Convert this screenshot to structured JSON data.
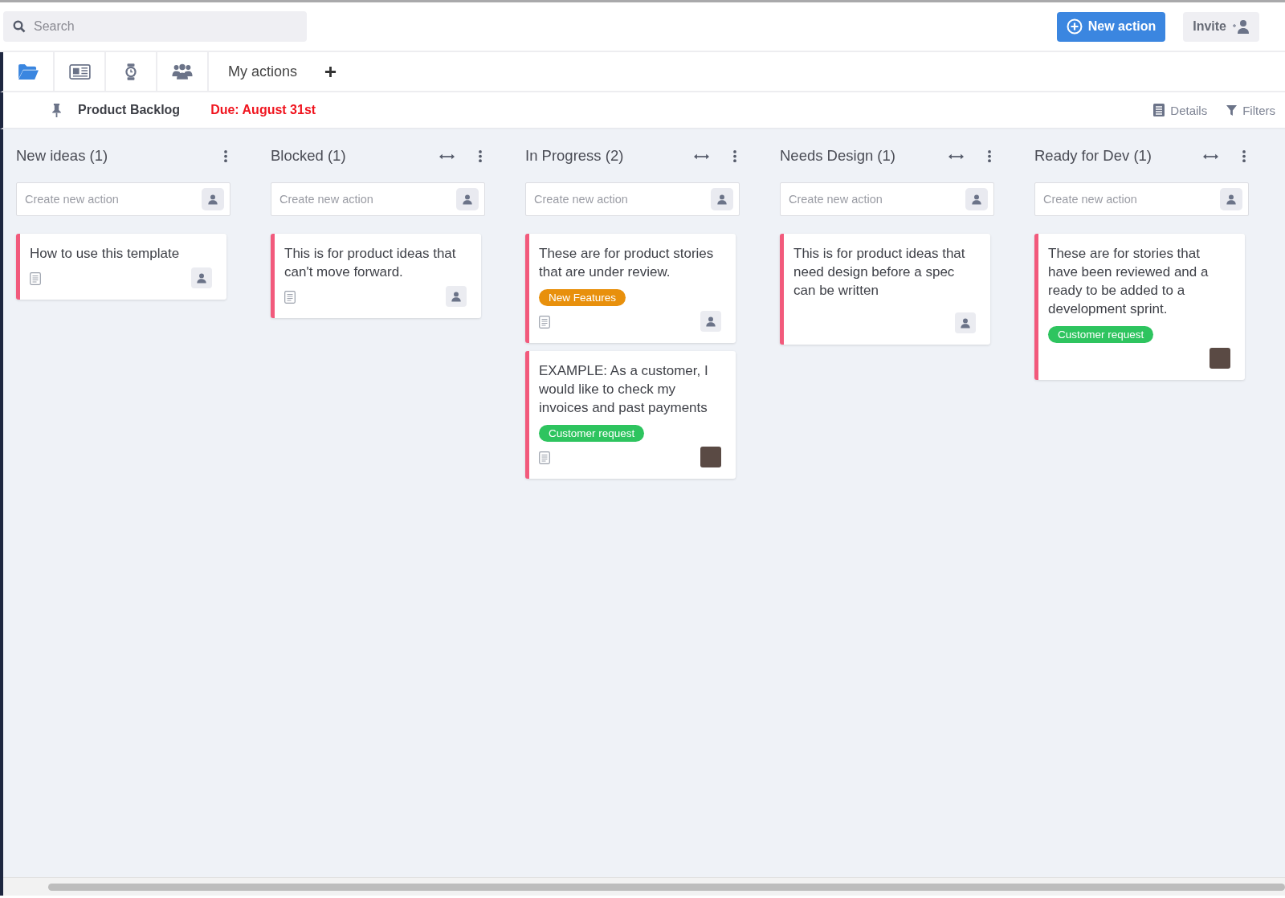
{
  "search": {
    "placeholder": "Search"
  },
  "header_buttons": [
    {
      "kind": "new",
      "label": "New action"
    },
    {
      "kind": "invite",
      "label": "Invite"
    }
  ],
  "view_tabs": [
    {
      "kind": "folder",
      "selected": true
    },
    {
      "kind": "newspaper",
      "selected": false
    },
    {
      "kind": "stopwatch",
      "selected": false
    },
    {
      "kind": "team",
      "selected": false
    },
    {
      "kind": "text",
      "label": "My actions",
      "selected": false
    }
  ],
  "project": {
    "name": "Product Backlog",
    "due": "Due: August 31st"
  },
  "toolbar": [
    {
      "kind": "details",
      "label": "Details"
    },
    {
      "kind": "filters",
      "label": "Filters"
    }
  ],
  "columns": [
    {
      "title": "New ideas (1)",
      "resize": false,
      "placeholder": "Create new action",
      "cards": [
        {
          "text": "How to use this template",
          "notes": true,
          "photo": false
        }
      ]
    },
    {
      "title": "Blocked (1)",
      "resize": true,
      "placeholder": "Create new action",
      "cards": [
        {
          "text": "This is for product ideas that can't move forward.",
          "notes": true,
          "photo": false
        }
      ]
    },
    {
      "title": "In Progress (2)",
      "resize": true,
      "placeholder": "Create new action",
      "cards": [
        {
          "text": "These are for product stories that are under review.",
          "tags": [
            {
              "label": "New Features",
              "color": "#e8900c"
            }
          ],
          "notes": true,
          "photo": false
        },
        {
          "text": "EXAMPLE: As a customer, I would like to check my invoices and past payments",
          "tags": [
            {
              "label": "Customer request",
              "color": "#2ec45f"
            }
          ],
          "notes": true,
          "photo": true
        }
      ]
    },
    {
      "title": "Needs Design (1)",
      "resize": true,
      "placeholder": "Create new action",
      "cards": [
        {
          "text": "This is for product ideas that need design before a spec can be written",
          "notes": false,
          "photo": false
        }
      ]
    },
    {
      "title": "Ready for Dev (1)",
      "resize": true,
      "placeholder": "Create new action",
      "cards": [
        {
          "text": "These are for stories that have been reviewed and a ready to be added to a development sprint.",
          "tags": [
            {
              "label": "Customer request",
              "color": "#2ec45f"
            }
          ],
          "notes": false,
          "photo": true
        }
      ]
    }
  ]
}
